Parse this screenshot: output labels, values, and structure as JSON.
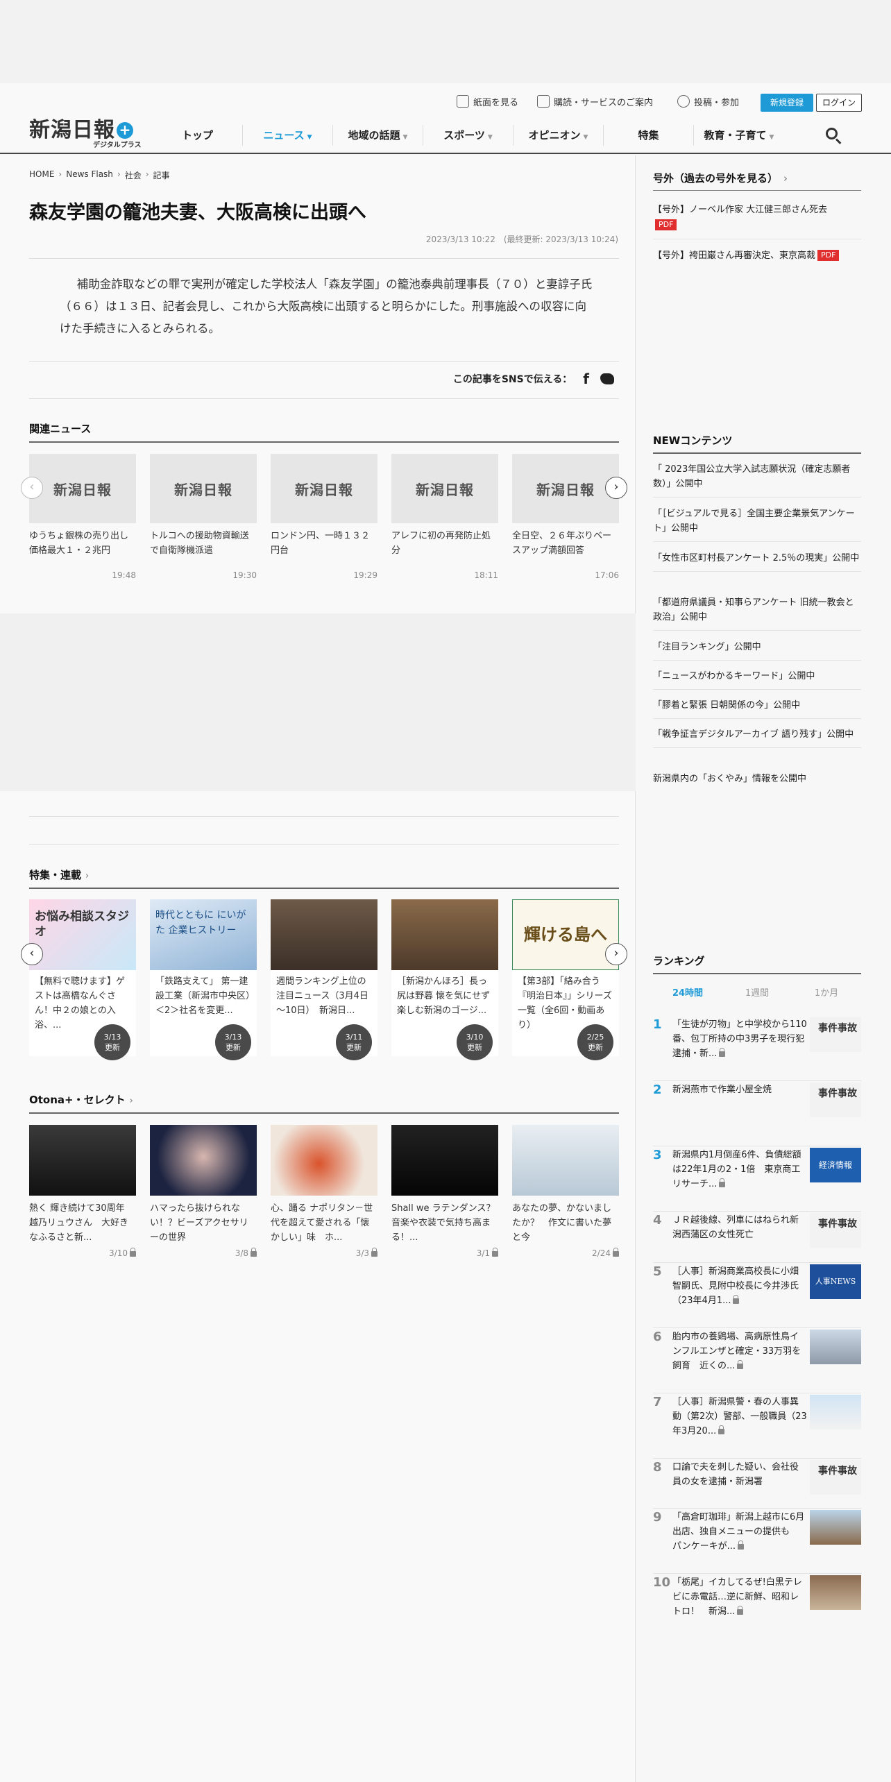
{
  "header": {
    "logo_text": "新潟日報",
    "logo_plus": "+",
    "logo_sub": "デジタルプラス",
    "util_links": [
      "紙面を見る",
      "購読・サービスのご案内",
      "投稿・参加"
    ],
    "register": "新規登録",
    "login": "ログイン",
    "nav": [
      "トップ",
      "ニュース",
      "地域の話題",
      "スポーツ",
      "オピニオン",
      "特集",
      "教育・子育て"
    ],
    "nav_caret": "▼",
    "active_nav": "ニュース"
  },
  "breadcrumb": [
    "HOME",
    "News Flash",
    "社会",
    "記事"
  ],
  "breadcrumb_sep": "›",
  "article": {
    "title": "森友学園の籠池夫妻、大阪高検に出頭へ",
    "dates": "2023/3/13 10:22　(最終更新: 2023/3/13 10:24)",
    "body": "補助金詐取などの罪で実刑が確定した学校法人「森友学園」の籠池泰典前理事長（７０）と妻諄子氏（６６）は１３日、記者会見し、これから大阪高検に出頭すると明らかにした。刑事施設への収容に向けた手続きに入るとみられる。",
    "sns_label": "この記事をSNSで伝える：",
    "sns_fb": "f"
  },
  "related": {
    "title": "関連ニュース",
    "thumb_text": "新潟日報",
    "items": [
      {
        "title": "ゆうちょ銀株の売り出し価格最大１・２兆円",
        "time": "19:48"
      },
      {
        "title": "トルコへの援助物資輸送で自衛隊機派遣",
        "time": "19:30"
      },
      {
        "title": "ロンドン円、一時１３２円台",
        "time": "19:29"
      },
      {
        "title": "アレフに初の再発防止処分",
        "time": "18:11"
      },
      {
        "title": "全日空、２６年ぶりベースアップ満額回答",
        "time": "17:06"
      }
    ]
  },
  "features": {
    "title": "特集・連載",
    "chev": "›",
    "items": [
      {
        "title": "【無料で聴けます】ゲストは高橋なんぐさん！中２の娘との入浴、...",
        "badge_date": "3/13",
        "badge_label": "更新",
        "thumb_text": "お悩み相談スタジオ"
      },
      {
        "title": "「鉄路支えて」 第一建設工業（新潟市中央区）＜2＞社名を変更...",
        "badge_date": "3/13",
        "badge_label": "更新",
        "thumb_text": "時代とともに にいがた 企業ヒストリー"
      },
      {
        "title": "週間ランキング上位の注目ニュース（3月4日～10日）　新潟日...",
        "badge_date": "3/11",
        "badge_label": "更新",
        "thumb_text": ""
      },
      {
        "title": "［新潟かんほろ］長っ尻は野暮 懐を気にせず楽しむ新潟のゴージ...",
        "badge_date": "3/10",
        "badge_label": "更新",
        "thumb_text": ""
      },
      {
        "title": "【第3部】「絡み合う『明治日本』」シリーズ一覧（全6回・動画あり）",
        "badge_date": "2/25",
        "badge_label": "更新",
        "thumb_text": "輝ける島へ"
      }
    ]
  },
  "otona": {
    "title": "Otona+・セレクト",
    "chev": "›",
    "items": [
      {
        "title": "熱く 輝き続けて30周年 越乃リュウさん　大好きなふるさと新...",
        "date": "3/10"
      },
      {
        "title": "ハマったら抜けられない！？ビーズアクセサリーの世界",
        "date": "3/8"
      },
      {
        "title": "心、踊る ナポリタン－世代を超えて愛される「懐かしい」味　ホ...",
        "date": "3/3"
      },
      {
        "title": "Shall we ラテンダンス？　音楽や衣装で気持ち高まる！...",
        "date": "3/1"
      },
      {
        "title": "あなたの夢、かないましたか？　作文に書いた夢と今",
        "date": "2/24"
      }
    ]
  },
  "sidebar": {
    "gogai_title": "号外（過去の号外を見る）",
    "gogai_chev": "›",
    "gogai": [
      {
        "title": "【号外】ノーベル作家 大江健三郎さん死去",
        "pdf": "PDF"
      },
      {
        "title": "【号外】袴田巌さん再審決定、東京高裁",
        "pdf": "PDF"
      }
    ],
    "new_title": "NEWコンテンツ",
    "new_items": [
      "「 2023年国公立大学入試志願状況（確定志願者数）」公開中",
      "「［ビジュアルで見る］全国主要企業景気アンケート」公開中",
      "「女性市区町村長アンケート 2.5％の現実」公開中",
      "「都道府県議員・知事らアンケート 旧統一教会と政治」公開中",
      "「注目ランキング」公開中",
      "「ニュースがわかるキーワード」公開中",
      "「膠着と緊張 日朝関係の今」公開中",
      "「戦争証言デジタルアーカイブ 語り残す」公開中",
      "新潟県内の「おくやみ」情報を公開中"
    ],
    "ranking_title": "ランキング",
    "ranking_tabs": [
      "24時間",
      "1週間",
      "1か月"
    ],
    "ranking": [
      {
        "rank": "1",
        "title": "「生徒が刃物」と中学校から110番、包丁所持の中3男子を現行犯逮捕・新...",
        "img": "事件事故",
        "lock": true
      },
      {
        "rank": "2",
        "title": "新潟燕市で作業小屋全焼",
        "img": "事件事故",
        "lock": false
      },
      {
        "rank": "3",
        "title": "新潟県内1月倒産6件、負債総額は22年1月の2・1倍　東京商工リサーチ...",
        "img": "経済情報",
        "lock": true
      },
      {
        "rank": "4",
        "title": "ＪＲ越後線、列車にはねられ新潟西蒲区の女性死亡",
        "img": "事件事故",
        "lock": false
      },
      {
        "rank": "5",
        "title": "［人事］新潟商業高校長に小畑智嗣氏、見附中校長に今井渉氏（23年4月1...",
        "img": "人事NEWS",
        "lock": true
      },
      {
        "rank": "6",
        "title": "胎内市の養鶏場、高病原性鳥インフルエンザと確定・33万羽を飼育　近くの...",
        "img": "",
        "lock": true
      },
      {
        "rank": "7",
        "title": "［人事］新潟県警・春の人事異動（第2次）警部、一般職員（23年3月20...",
        "img": "",
        "lock": true
      },
      {
        "rank": "8",
        "title": "口論で夫を刺した疑い、会社役員の女を逮捕・新潟署",
        "img": "事件事故",
        "lock": false
      },
      {
        "rank": "9",
        "title": "「高倉町珈琲」新潟上越市に6月出店、独自メニューの提供も　パンケーキが...",
        "img": "",
        "lock": true
      },
      {
        "rank": "10",
        "title": "「栃尾」イカしてるぜ!白黒テレビに赤電話…逆に新鮮、昭和レトロ！　新潟...",
        "img": "",
        "lock": true
      }
    ]
  },
  "colors": {
    "accent": "#1e9bd7",
    "pdf": "#e02e2e",
    "badge": "#4a4a4a"
  }
}
